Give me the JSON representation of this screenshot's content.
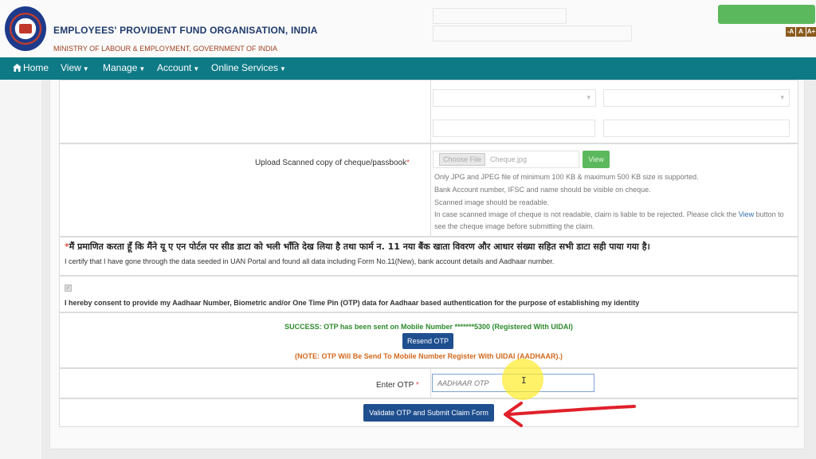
{
  "header": {
    "org_title": "EMPLOYEES' PROVIDENT FUND ORGANISATION, INDIA",
    "org_subtitle": "MINISTRY OF LABOUR & EMPLOYMENT, GOVERNMENT OF INDIA",
    "font_buttons": [
      "-A",
      "A",
      "A+"
    ]
  },
  "nav": {
    "items": [
      {
        "label": "Home",
        "icon": "home-icon"
      },
      {
        "label": "View"
      },
      {
        "label": "Manage"
      },
      {
        "label": "Account"
      },
      {
        "label": "Online Services"
      }
    ]
  },
  "form": {
    "upload_label": "Upload Scanned copy of cheque/passbook",
    "required_mark": "*",
    "choose_file": "Choose File",
    "file_name": "Cheque.jpg",
    "view_button": "View",
    "hints": [
      "Only JPG and JPEG file of minimum 100 KB & maximum 500 KB size is supported.",
      "Bank Account number, IFSC and name should be visible on cheque.",
      "Scanned image should be readable."
    ],
    "hint_reject_before": "In case scanned image of cheque is not readable, claim is liable to be rejected. Please click the ",
    "hint_reject_link": "View",
    "hint_reject_after": " button to",
    "hint_reject_line2": "see the cheque image before submitting the claim.",
    "certify_hindi": "मैं प्रमाणित करता हूँ कि मैंने यू ए एन पोर्टल पर सीड डाटा को भली भाँति देख लिया है तथा फार्म न. 11 नया बैंक खाता विवरण और आधार संख्या सहित सभी डाटा सही पाया गया है।",
    "certify_english": "I certify that I have gone through the data seeded in UAN Portal and found all data including Form No.11(New), bank account details and Aadhaar number.",
    "consent": "I hereby consent to provide my Aadhaar Number, Biometric and/or One Time Pin (OTP) data for Aadhaar based authentication for the purpose of establishing my identity",
    "success_message": "SUCCESS: OTP has been sent on Mobile Number *******5300 (Registered With UIDAI)",
    "resend_button": "Resend OTP",
    "note": "(NOTE: OTP Will Be Send To Mobile Number Register With UIDAI (AADHAAR).)",
    "otp_label": "Enter OTP",
    "otp_placeholder": "AADHAAR OTP",
    "otp_value": "",
    "validate_button": "Validate OTP and Submit Claim Form"
  },
  "colors": {
    "navbar": "#0e7a86",
    "primary_button": "#1f4f8f",
    "success_text": "#2c8a2c",
    "note_text": "#d2691e",
    "view_button": "#5cb85c",
    "annotation_arrow": "#e0202a",
    "cursor_highlight": "#ffeb28"
  }
}
